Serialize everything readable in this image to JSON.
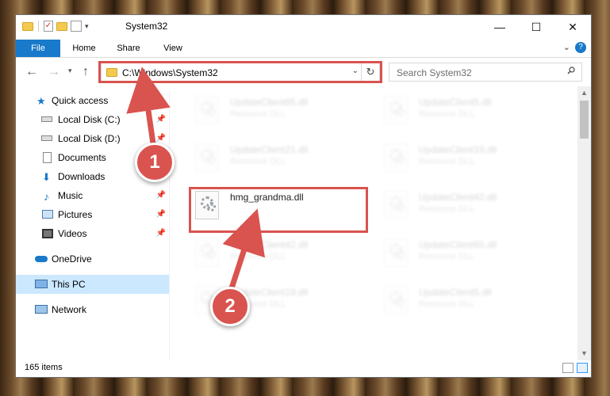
{
  "window": {
    "title": "System32",
    "controls": {
      "minimize": "—",
      "maximize": "☐",
      "close": "✕"
    }
  },
  "ribbon": {
    "tabs": [
      "File",
      "Home",
      "Share",
      "View"
    ]
  },
  "address_bar": {
    "path": "C:\\Windows\\System32",
    "search_placeholder": "Search System32"
  },
  "nav_pane": {
    "items": [
      {
        "label": "Quick access",
        "icon": "star-icon",
        "pinned": false
      },
      {
        "label": "Local Disk (C:)",
        "icon": "drive-icon",
        "pinned": true
      },
      {
        "label": "Local Disk (D:)",
        "icon": "drive-icon",
        "pinned": true
      },
      {
        "label": "Documents",
        "icon": "documents-icon",
        "pinned": true
      },
      {
        "label": "Downloads",
        "icon": "download-icon",
        "pinned": true
      },
      {
        "label": "Music",
        "icon": "music-icon",
        "pinned": true
      },
      {
        "label": "Pictures",
        "icon": "pictures-icon",
        "pinned": true
      },
      {
        "label": "Videos",
        "icon": "videos-icon",
        "pinned": true
      },
      {
        "label": "OneDrive",
        "icon": "cloud-icon",
        "pinned": false
      },
      {
        "label": "This PC",
        "icon": "computer-icon",
        "pinned": false,
        "selected": true
      },
      {
        "label": "Network",
        "icon": "network-icon",
        "pinned": false
      }
    ]
  },
  "files": [
    {
      "name": "UpdateClient65.dll",
      "type": "Resource DLL",
      "faded": true
    },
    {
      "name": "UpdateClient5.dll",
      "type": "Resource DLL",
      "faded": true
    },
    {
      "name": "UpdateClient21.dll",
      "type": "Resource DLL",
      "faded": true
    },
    {
      "name": "UpdateClient19.dll",
      "type": "Resource DLL",
      "faded": true
    },
    {
      "name": "hmg_grandma.dll",
      "type": "",
      "faded": false,
      "highlighted": true
    },
    {
      "name": "UpdateClient42.dll",
      "type": "Resource DLL",
      "faded": true
    },
    {
      "name": "UpdateClient42.dll",
      "type": "Resource DLL",
      "faded": true
    },
    {
      "name": "UpdateClient65.dll",
      "type": "Resource DLL",
      "faded": true
    },
    {
      "name": "UpdateClient19.dll",
      "type": "Resource DLL",
      "faded": true
    },
    {
      "name": "UpdateClient5.dll",
      "type": "Resource DLL",
      "faded": true
    }
  ],
  "status": {
    "item_count": "165 items"
  },
  "annotations": {
    "step1": "1",
    "step2": "2",
    "highlight_color": "#d9534f"
  },
  "colors": {
    "accent": "#1979ca",
    "selection": "#cce8ff"
  }
}
